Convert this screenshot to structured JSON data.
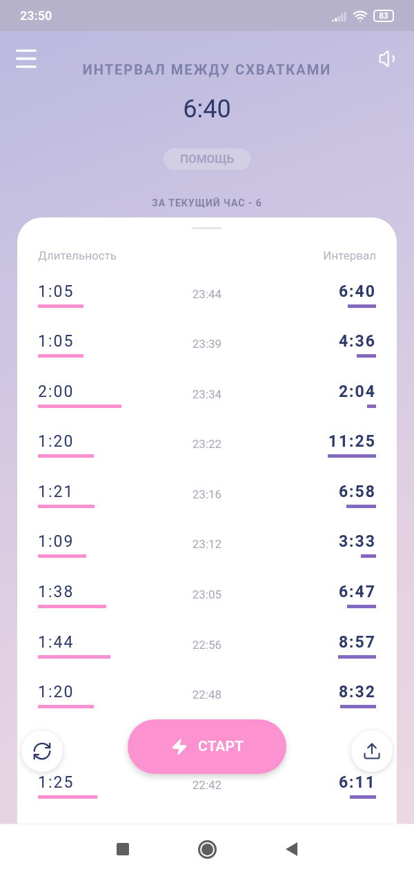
{
  "status_bar": {
    "time": "23:50",
    "battery": "83"
  },
  "header": {
    "title": "ИНТЕРВАЛ МЕЖДУ СХВАТКАМИ",
    "interval": "6:40",
    "help_button": "ПОМОЩЬ",
    "hour_count": "ЗА ТЕКУЩИЙ ЧАС - 6"
  },
  "table": {
    "columns": [
      "Длительность",
      "Интервал"
    ],
    "rows": [
      {
        "duration": "1:05",
        "time": "23:44",
        "interval": "6:40"
      },
      {
        "duration": "1:05",
        "time": "23:39",
        "interval": "4:36"
      },
      {
        "duration": "2:00",
        "time": "23:34",
        "interval": "2:04"
      },
      {
        "duration": "1:20",
        "time": "23:22",
        "interval": "11:25"
      },
      {
        "duration": "1:21",
        "time": "23:16",
        "interval": "6:58"
      },
      {
        "duration": "1:09",
        "time": "23:12",
        "interval": "3:33"
      },
      {
        "duration": "1:38",
        "time": "23:05",
        "interval": "6:47"
      },
      {
        "duration": "1:44",
        "time": "22:56",
        "interval": "8:57"
      },
      {
        "duration": "1:20",
        "time": "22:48",
        "interval": "8:32"
      },
      {
        "duration": "1:25",
        "time": "22:42",
        "interval": "6:11"
      }
    ]
  },
  "start_button": {
    "label": "СТАРТ"
  }
}
